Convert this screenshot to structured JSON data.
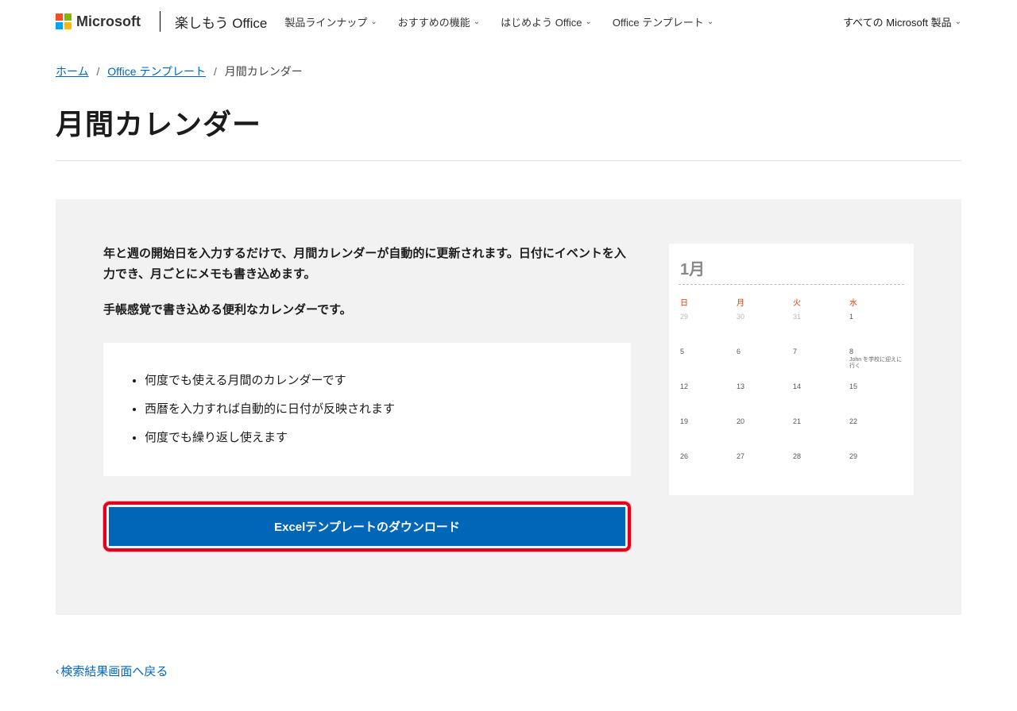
{
  "header": {
    "brand": "Microsoft",
    "sitename": "楽しもう Office",
    "nav": [
      {
        "label": "製品ラインナップ"
      },
      {
        "label": "おすすめの機能"
      },
      {
        "label": "はじめよう Office"
      },
      {
        "label": "Office テンプレート"
      }
    ],
    "right_label": "すべての Microsoft 製品"
  },
  "breadcrumb": {
    "home": "ホーム",
    "templates": "Office テンプレート",
    "current": "月間カレンダー"
  },
  "title": "月間カレンダー",
  "lead1": "年と週の開始日を入力するだけで、月間カレンダーが自動的に更新されます。日付にイベントを入力でき、月ごとにメモも書き込めます。",
  "lead2": "手帳感覚で書き込める便利なカレンダーです。",
  "features": [
    "何度でも使える月間のカレンダーです",
    "西暦を入力すれば自動的に日付が反映されます",
    "何度でも繰り返し使えます"
  ],
  "download_label": "Excelテンプレートのダウンロード",
  "calendar": {
    "month": "1月",
    "day_headers": [
      "日",
      "月",
      "火",
      "水"
    ],
    "rows": [
      [
        {
          "d": "29",
          "dim": true
        },
        {
          "d": "30",
          "dim": true
        },
        {
          "d": "31",
          "dim": true
        },
        {
          "d": "1"
        }
      ],
      [
        {
          "d": "5"
        },
        {
          "d": "6"
        },
        {
          "d": "7"
        },
        {
          "d": "8",
          "note": "John を学校に迎えに行く"
        }
      ],
      [
        {
          "d": "12"
        },
        {
          "d": "13"
        },
        {
          "d": "14"
        },
        {
          "d": "15"
        }
      ],
      [
        {
          "d": "19"
        },
        {
          "d": "20"
        },
        {
          "d": "21"
        },
        {
          "d": "22"
        }
      ],
      [
        {
          "d": "26"
        },
        {
          "d": "27"
        },
        {
          "d": "28"
        },
        {
          "d": "29"
        }
      ]
    ]
  },
  "back_link": "検索結果画面へ戻る"
}
